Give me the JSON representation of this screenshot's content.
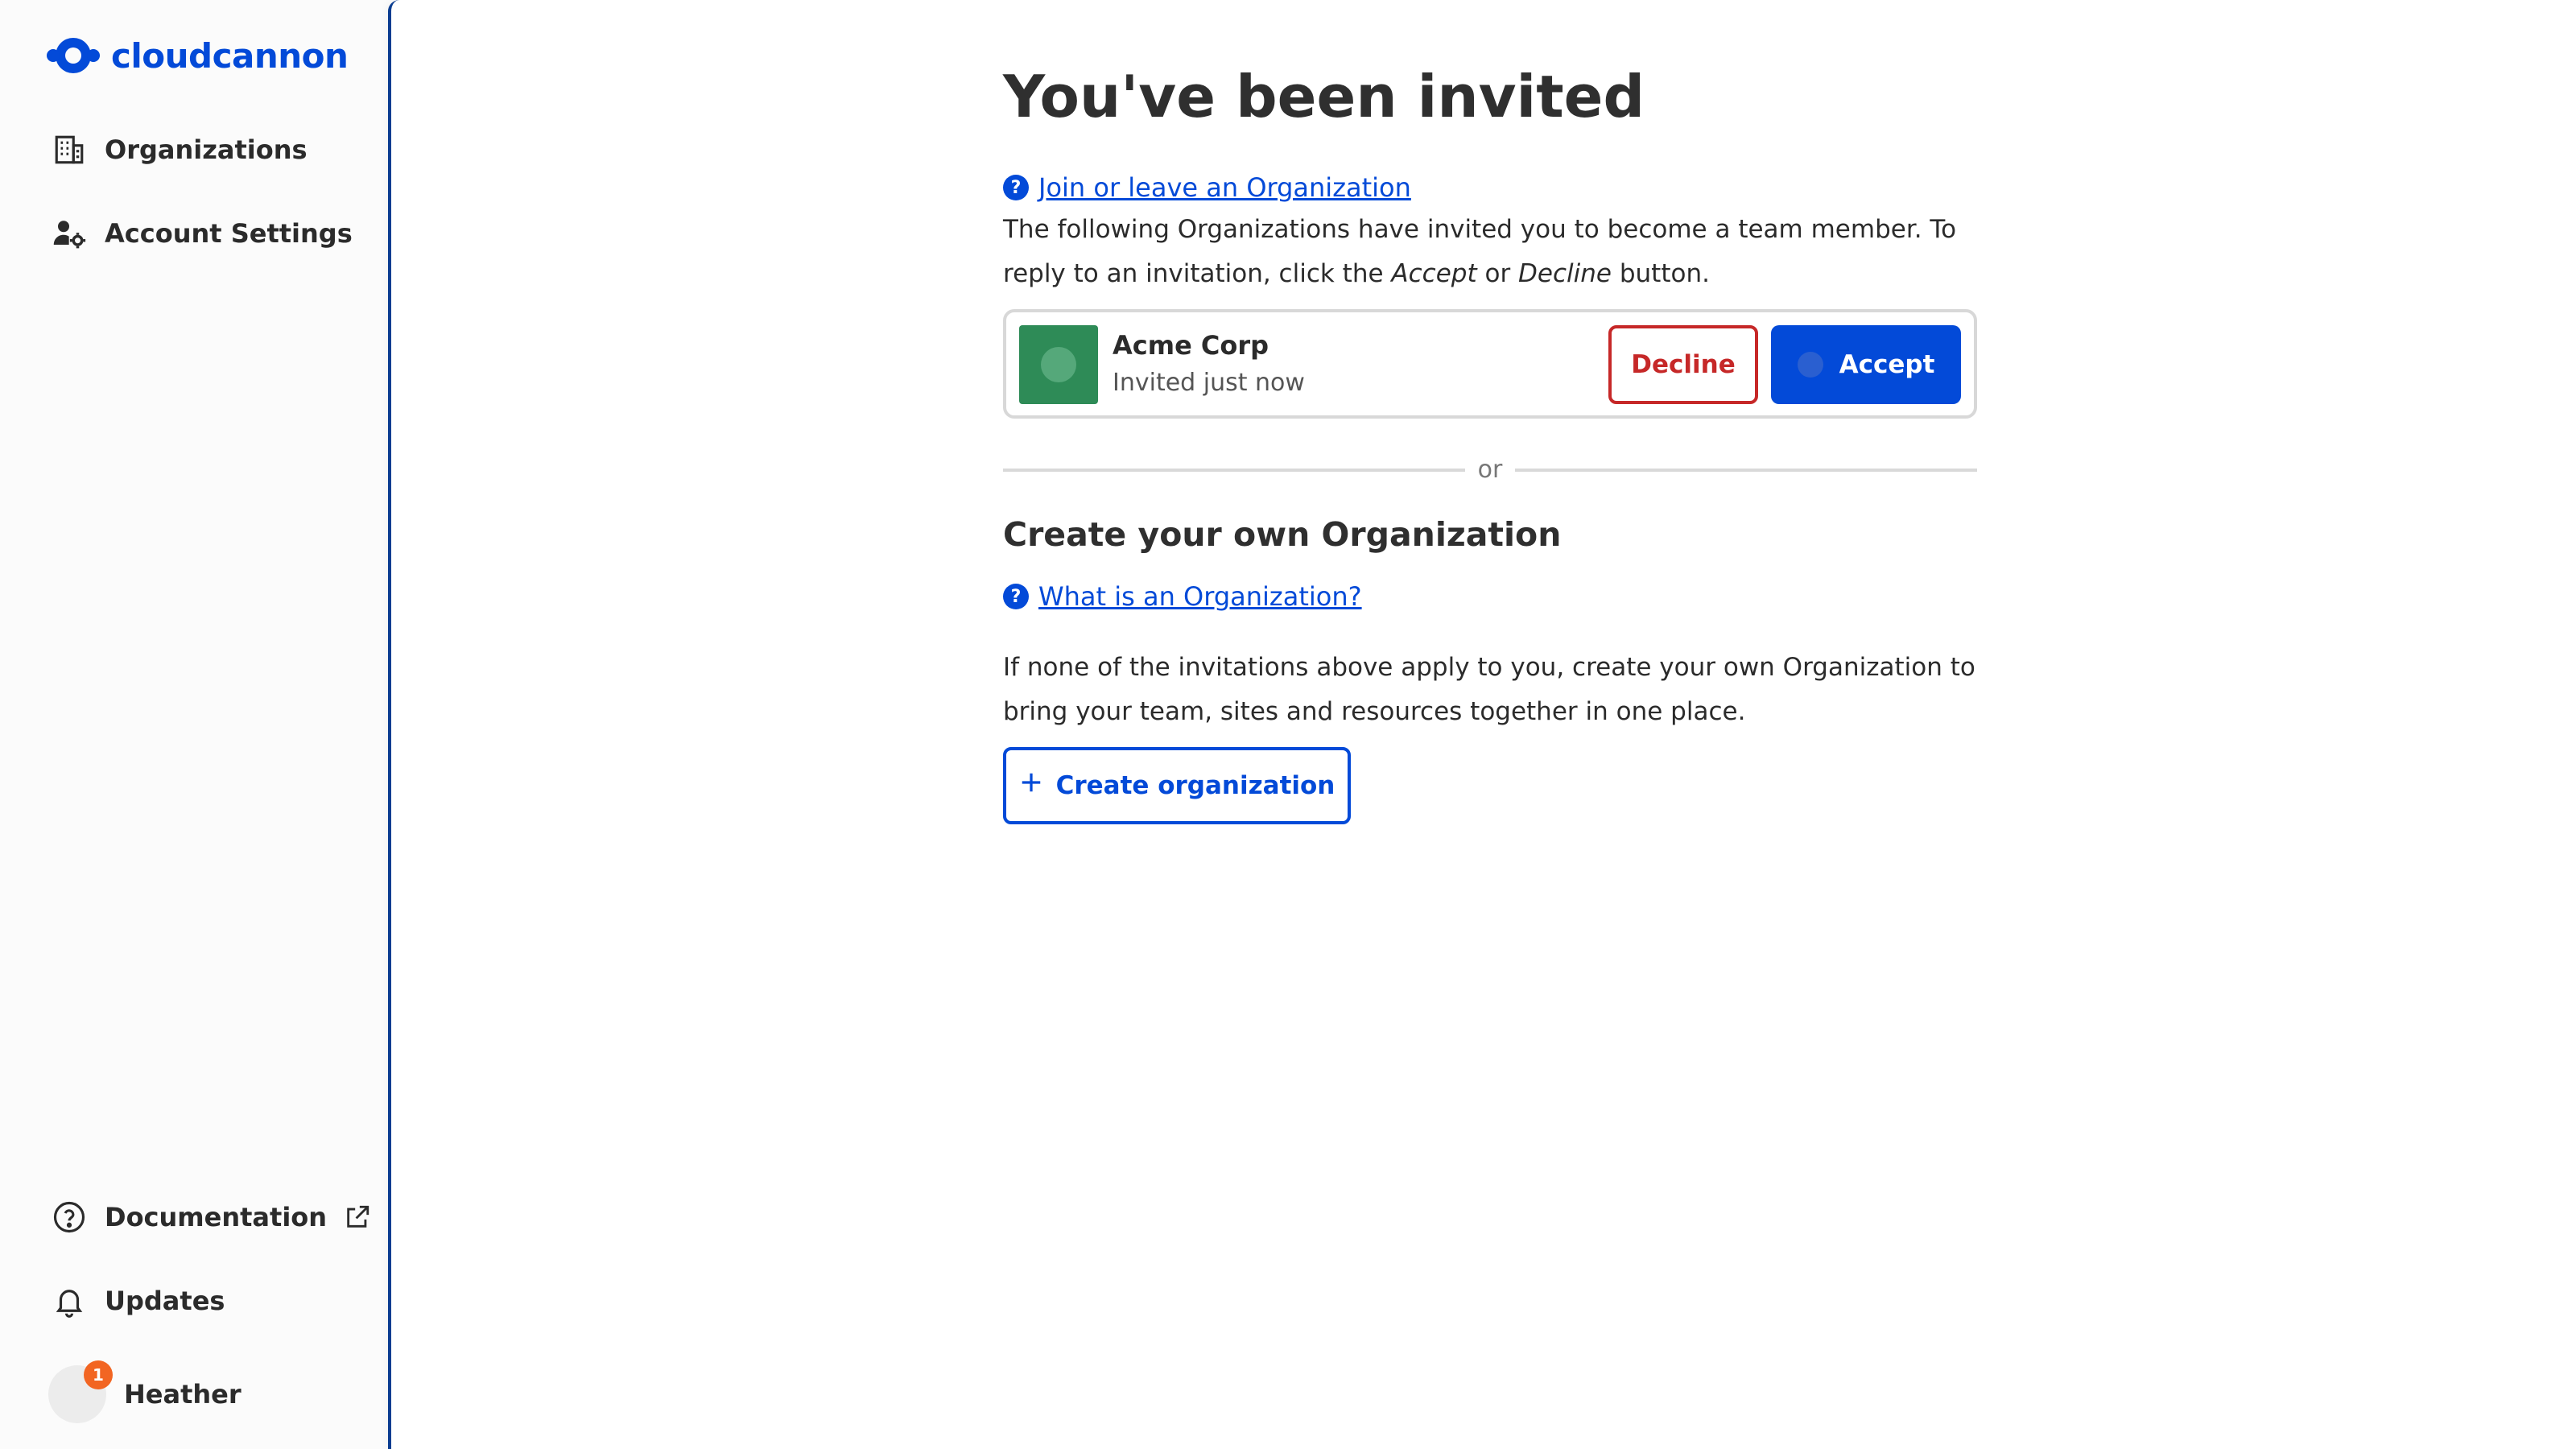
{
  "brand": {
    "name": "cloudcannon",
    "color": "#034ad8"
  },
  "sidebar": {
    "nav": [
      {
        "label": "Organizations",
        "icon": "building-icon"
      },
      {
        "label": "Account Settings",
        "icon": "user-gear-icon"
      }
    ],
    "footer": [
      {
        "label": "Documentation",
        "icon": "question-circle-icon",
        "external": true
      },
      {
        "label": "Updates",
        "icon": "bell-icon"
      }
    ],
    "user": {
      "name": "Heather",
      "notification_count": "1"
    }
  },
  "main": {
    "title": "You've been invited",
    "join_link": "Join or leave an Organization",
    "intro_part1": "The following Organizations have invited you to become a team member. To reply to an invitation, click the ",
    "intro_accept": "Accept",
    "intro_or": " or ",
    "intro_decline": "Decline",
    "intro_part2": " button.",
    "invitation": {
      "org_name": "Acme Corp",
      "meta": "Invited just now",
      "avatar_color": "#2e8b57",
      "decline_label": "Decline",
      "accept_label": "Accept"
    },
    "divider_text": "or",
    "create_title": "Create your own Organization",
    "what_link": "What is an Organization?",
    "create_text": "If none of the invitations above apply to you, create your own Organization to bring your team, sites and resources together in one place.",
    "create_button": "Create organization"
  },
  "colors": {
    "primary": "#034ad8",
    "danger": "#c62828",
    "badge": "#f26522"
  }
}
